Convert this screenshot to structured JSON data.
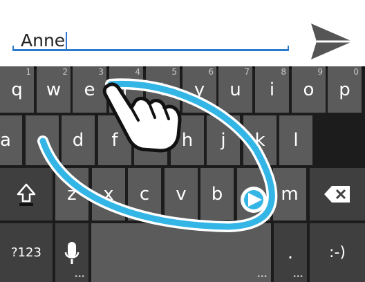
{
  "text_field": {
    "value": "Anne"
  },
  "send_button": {
    "icon": "send-icon"
  },
  "keyboard": {
    "row1": [
      {
        "label": "q",
        "hint": "1"
      },
      {
        "label": "w",
        "hint": "2"
      },
      {
        "label": "e",
        "hint": "3"
      },
      {
        "label": "r",
        "hint": "4"
      },
      {
        "label": "t",
        "hint": "5"
      },
      {
        "label": "y",
        "hint": "6"
      },
      {
        "label": "u",
        "hint": "7"
      },
      {
        "label": "i",
        "hint": "8"
      },
      {
        "label": "o",
        "hint": "9"
      },
      {
        "label": "p",
        "hint": "0"
      }
    ],
    "row2": [
      "a",
      "s",
      "d",
      "f",
      "g",
      "h",
      "j",
      "k",
      "l"
    ],
    "row3": [
      "z",
      "x",
      "c",
      "v",
      "b",
      "n",
      "m"
    ],
    "shift_icon": "shift-icon",
    "backspace_icon": "backspace-icon",
    "symbols_label": "?123",
    "mic_icon": "microphone-icon",
    "period_label": ".",
    "smiley_label": ":-)"
  },
  "gesture_overlay": {
    "icon": "pointing-hand-icon",
    "trail_color": "#33b5e5"
  },
  "colors": {
    "accent": "#2a7ad0",
    "key": "#5b5b5b",
    "key_dark": "#3f3f3f",
    "keyboard_bg": "#1c1c1c"
  }
}
